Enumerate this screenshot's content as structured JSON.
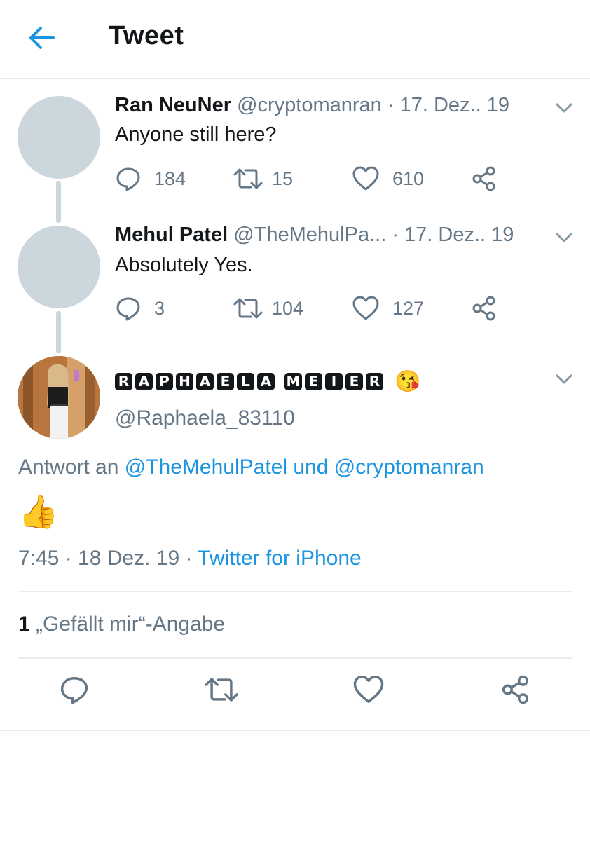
{
  "header": {
    "title": "Tweet"
  },
  "thread": [
    {
      "name": "Ran NeuNer",
      "handle_and_date": "@cryptomanran · 17. Dez.. 19",
      "text": "Anyone still here?",
      "replies": "184",
      "retweets": "15",
      "likes": "610"
    },
    {
      "name": "Mehul Patel",
      "handle_and_date": "@TheMehulPa... · 17. Dez.. 19",
      "text": "Absolutely Yes.",
      "replies": "3",
      "retweets": "104",
      "likes": "127"
    }
  ],
  "main_tweet": {
    "display_name_letters_1": [
      "R",
      "A",
      "P",
      "H",
      "A",
      "E",
      "L",
      "A"
    ],
    "display_name_letters_2": [
      "M",
      "E",
      "I",
      "E",
      "R"
    ],
    "emoji": "😘",
    "handle": "@Raphaela_83110",
    "reply_prefix": "Antwort an",
    "reply_mention_1": "@TheMehulPatel",
    "reply_and": "und",
    "reply_mention_2": "@cryptomanran",
    "body_emoji": "👍",
    "time_date": "7:45 · 18 Dez. 19 ·",
    "source": "Twitter for iPhone",
    "like_count": "1",
    "like_label": "„Gefällt mir“-Angabe"
  },
  "colors": {
    "accent": "#1b95e0",
    "muted": "#657786",
    "text": "#14171a",
    "divider": "#e6ecf0",
    "avatar_placeholder": "#ccd6dd"
  },
  "icons": [
    "back-arrow-icon",
    "chevron-down-icon",
    "reply-icon",
    "retweet-icon",
    "like-icon",
    "share-icon"
  ]
}
